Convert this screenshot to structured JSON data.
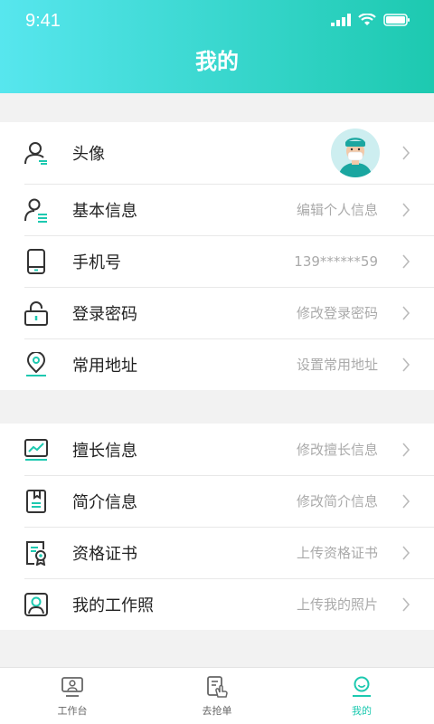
{
  "status_bar": {
    "time": "9:41"
  },
  "header": {
    "title": "我的"
  },
  "group1": [
    {
      "name": "avatar",
      "icon": "person-icon",
      "label": "头像",
      "value": ""
    },
    {
      "name": "basic-info",
      "icon": "person-info-icon",
      "label": "基本信息",
      "value": "编辑个人信息"
    },
    {
      "name": "phone",
      "icon": "phone-icon",
      "label": "手机号",
      "value": "139******59"
    },
    {
      "name": "password",
      "icon": "lock-icon",
      "label": "登录密码",
      "value": "修改登录密码"
    },
    {
      "name": "address",
      "icon": "location-pin-icon",
      "label": "常用地址",
      "value": "设置常用地址"
    }
  ],
  "group2": [
    {
      "name": "specialty",
      "icon": "chart-icon",
      "label": "擅长信息",
      "value": "修改擅长信息"
    },
    {
      "name": "intro",
      "icon": "book-icon",
      "label": "简介信息",
      "value": "修改简介信息"
    },
    {
      "name": "certificate",
      "icon": "certificate-icon",
      "label": "资格证书",
      "value": "上传资格证书"
    },
    {
      "name": "work-photo",
      "icon": "id-photo-icon",
      "label": "我的工作照",
      "value": "上传我的照片"
    }
  ],
  "tabbar": [
    {
      "label": "工作台",
      "icon": "workbench-icon",
      "active": false
    },
    {
      "label": "去抢单",
      "icon": "grab-order-icon",
      "active": false
    },
    {
      "label": "我的",
      "icon": "profile-icon",
      "active": true
    }
  ],
  "colors": {
    "accent": "#1dc9b0",
    "gradient_start": "#57e6ee",
    "icon_dark": "#333333"
  }
}
